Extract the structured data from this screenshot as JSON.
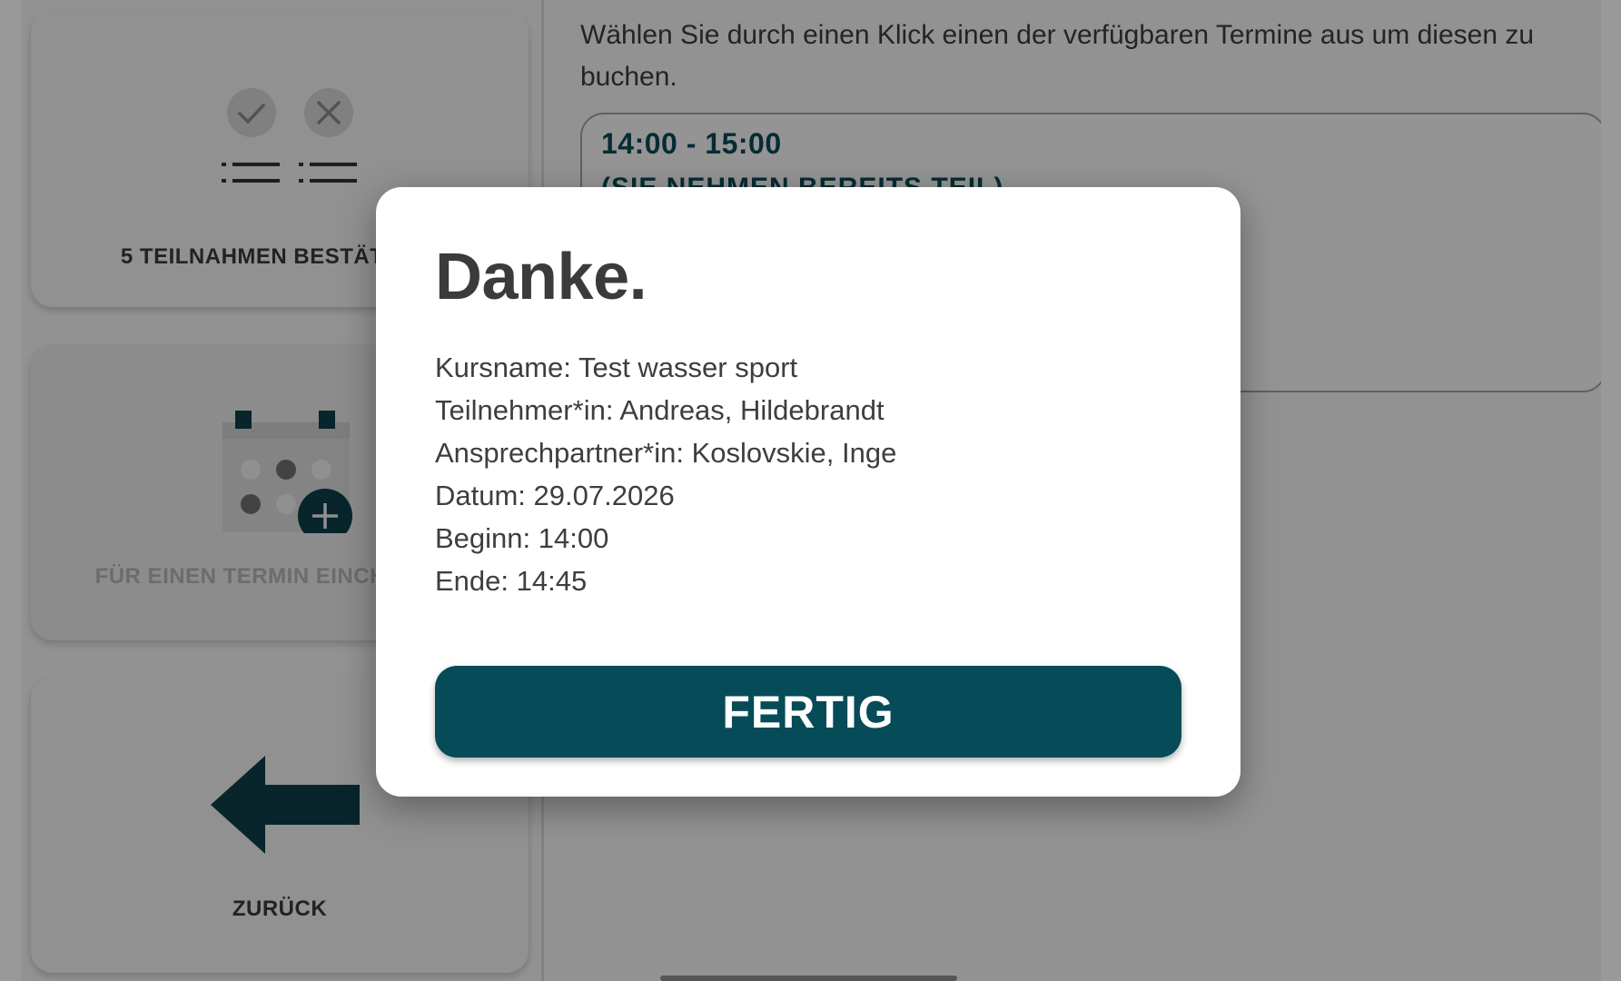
{
  "sidebar": {
    "confirm_card_label": "5 TEILNAHMEN BESTÄTIGEN",
    "register_card_label": "FÜR EINEN TERMIN EINCHECKEN",
    "back_card_label": "ZURÜCK"
  },
  "main": {
    "instruction": "Wählen Sie durch einen Klick einen der verfügbaren Termine aus um diesen zu buchen.",
    "slot": {
      "time": "14:00 - 15:00",
      "note": "(SIE NEHMEN BEREITS TEIL)"
    }
  },
  "dialog": {
    "title": "Danke.",
    "lines": [
      "Kursname: Test wasser sport",
      "Teilnehmer*in: Andreas, Hildebrandt",
      "Ansprechpartner*in: Koslovskie, Inge",
      "Datum: 29.07.2026",
      "Beginn: 14:00",
      "Ende: 14:45"
    ],
    "done_label": "FERTIG"
  },
  "colors": {
    "brand": "#064b58",
    "overlay": "rgba(0,0,0,0.40)"
  }
}
